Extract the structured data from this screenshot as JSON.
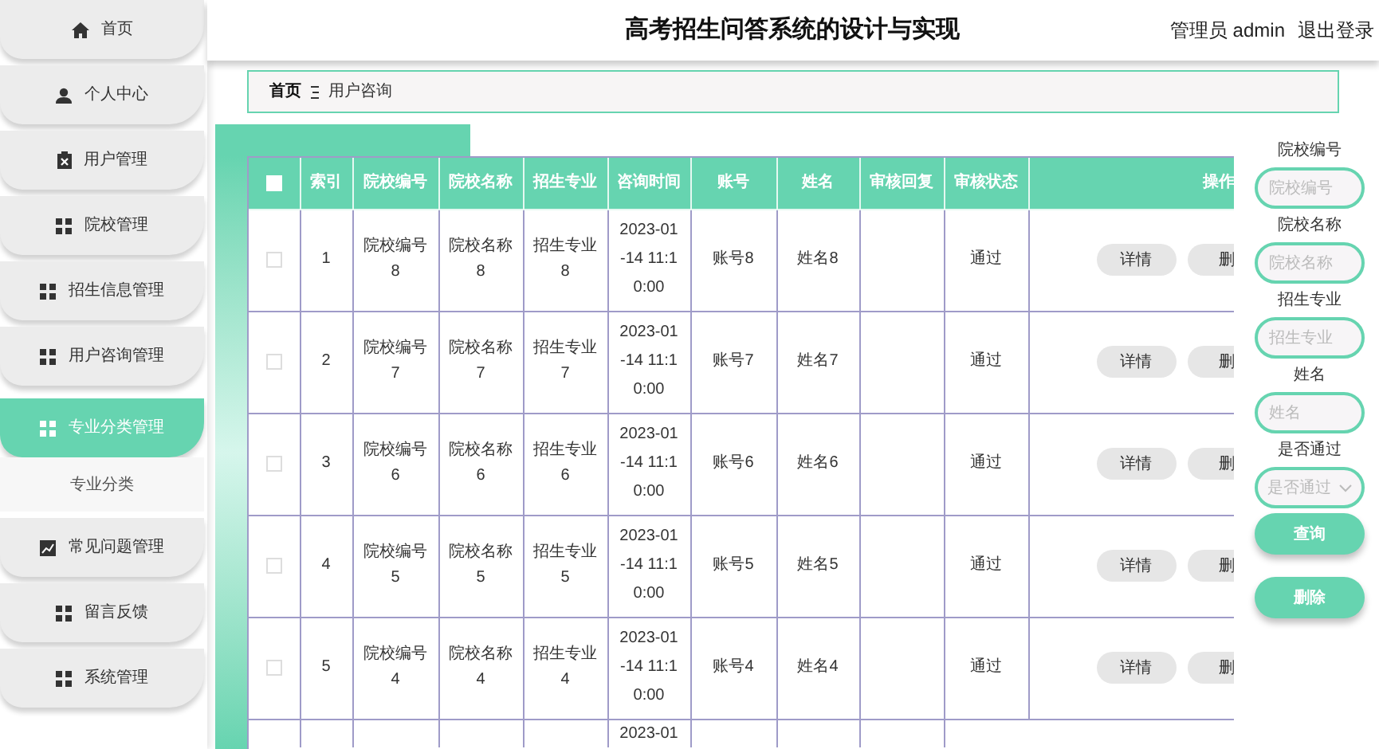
{
  "header": {
    "title": "高考招生问答系统的设计与实现",
    "user": "管理员 admin",
    "logout": "退出登录"
  },
  "sidebar": {
    "items": [
      {
        "label": "首页",
        "selected": false
      },
      {
        "label": "个人中心",
        "selected": false
      },
      {
        "label": "用户管理",
        "selected": false
      },
      {
        "label": "院校管理",
        "selected": false
      },
      {
        "label": "招生信息管理",
        "selected": false
      },
      {
        "label": "用户咨询管理",
        "selected": false
      },
      {
        "label": "专业分类管理",
        "selected": true,
        "expanded": true,
        "children": [
          {
            "label": "专业分类",
            "selected": false
          }
        ]
      },
      {
        "label": "常见问题管理",
        "selected": false
      },
      {
        "label": "留言反馈",
        "selected": false
      },
      {
        "label": "系统管理",
        "selected": false
      }
    ]
  },
  "breadcrumb": [
    {
      "label": "首页"
    },
    {
      "label": "用户咨询"
    }
  ],
  "table": {
    "select_all": {
      "checked": false
    },
    "columns": [
      "索引",
      "院校编号",
      "院校名称",
      "招生专业",
      "咨询时间",
      "账号",
      "姓名",
      "审核回复",
      "审核状态",
      "操作"
    ],
    "rows": [
      {
        "checked": false,
        "index": "1",
        "school_code": "院校编号8",
        "school_name": "院校名称8",
        "major": "招生专业8",
        "time": "2023-01-14 11:10:00",
        "account": "账号8",
        "name": "姓名8",
        "status": "通过",
        "actions": [
          "详情",
          "删"
        ]
      },
      {
        "checked": false,
        "index": "2",
        "school_code": "院校编号7",
        "school_name": "院校名称7",
        "major": "招生专业7",
        "time": "2023-01-14 11:10:00",
        "account": "账号7",
        "name": "姓名7",
        "status": "通过",
        "actions": [
          "详情",
          "删"
        ]
      },
      {
        "checked": false,
        "index": "3",
        "school_code": "院校编号6",
        "school_name": "院校名称6",
        "major": "招生专业6",
        "time": "2023-01-14 11:10:00",
        "account": "账号6",
        "name": "姓名6",
        "status": "通过",
        "actions": [
          "详情",
          "删"
        ]
      },
      {
        "checked": false,
        "index": "4",
        "school_code": "院校编号5",
        "school_name": "院校名称5",
        "major": "招生专业5",
        "time": "2023-01-14 11:10:00",
        "account": "账号5",
        "name": "姓名5",
        "status": "通过",
        "actions": [
          "详情",
          "删"
        ]
      },
      {
        "checked": false,
        "index": "5",
        "school_code": "院校编号4",
        "school_name": "院校名称4",
        "major": "招生专业4",
        "time": "2023-01-14 11:10:00",
        "account": "账号4",
        "name": "姓名4",
        "status": "通过",
        "actions": [
          "详情",
          "删"
        ]
      }
    ],
    "partial_row": {
      "time": "2023-01"
    }
  },
  "filters": {
    "fields": [
      {
        "kind": "input",
        "label": "院校编号",
        "placeholder": "院校编号"
      },
      {
        "kind": "input",
        "label": "院校名称",
        "placeholder": "院校名称"
      },
      {
        "kind": "input",
        "label": "招生专业",
        "placeholder": "招生专业"
      },
      {
        "kind": "input",
        "label": "姓名",
        "placeholder": "姓名"
      },
      {
        "kind": "select",
        "label": "是否通过",
        "placeholder": "是否通过"
      }
    ],
    "buttons": [
      "查询",
      "删除"
    ]
  }
}
